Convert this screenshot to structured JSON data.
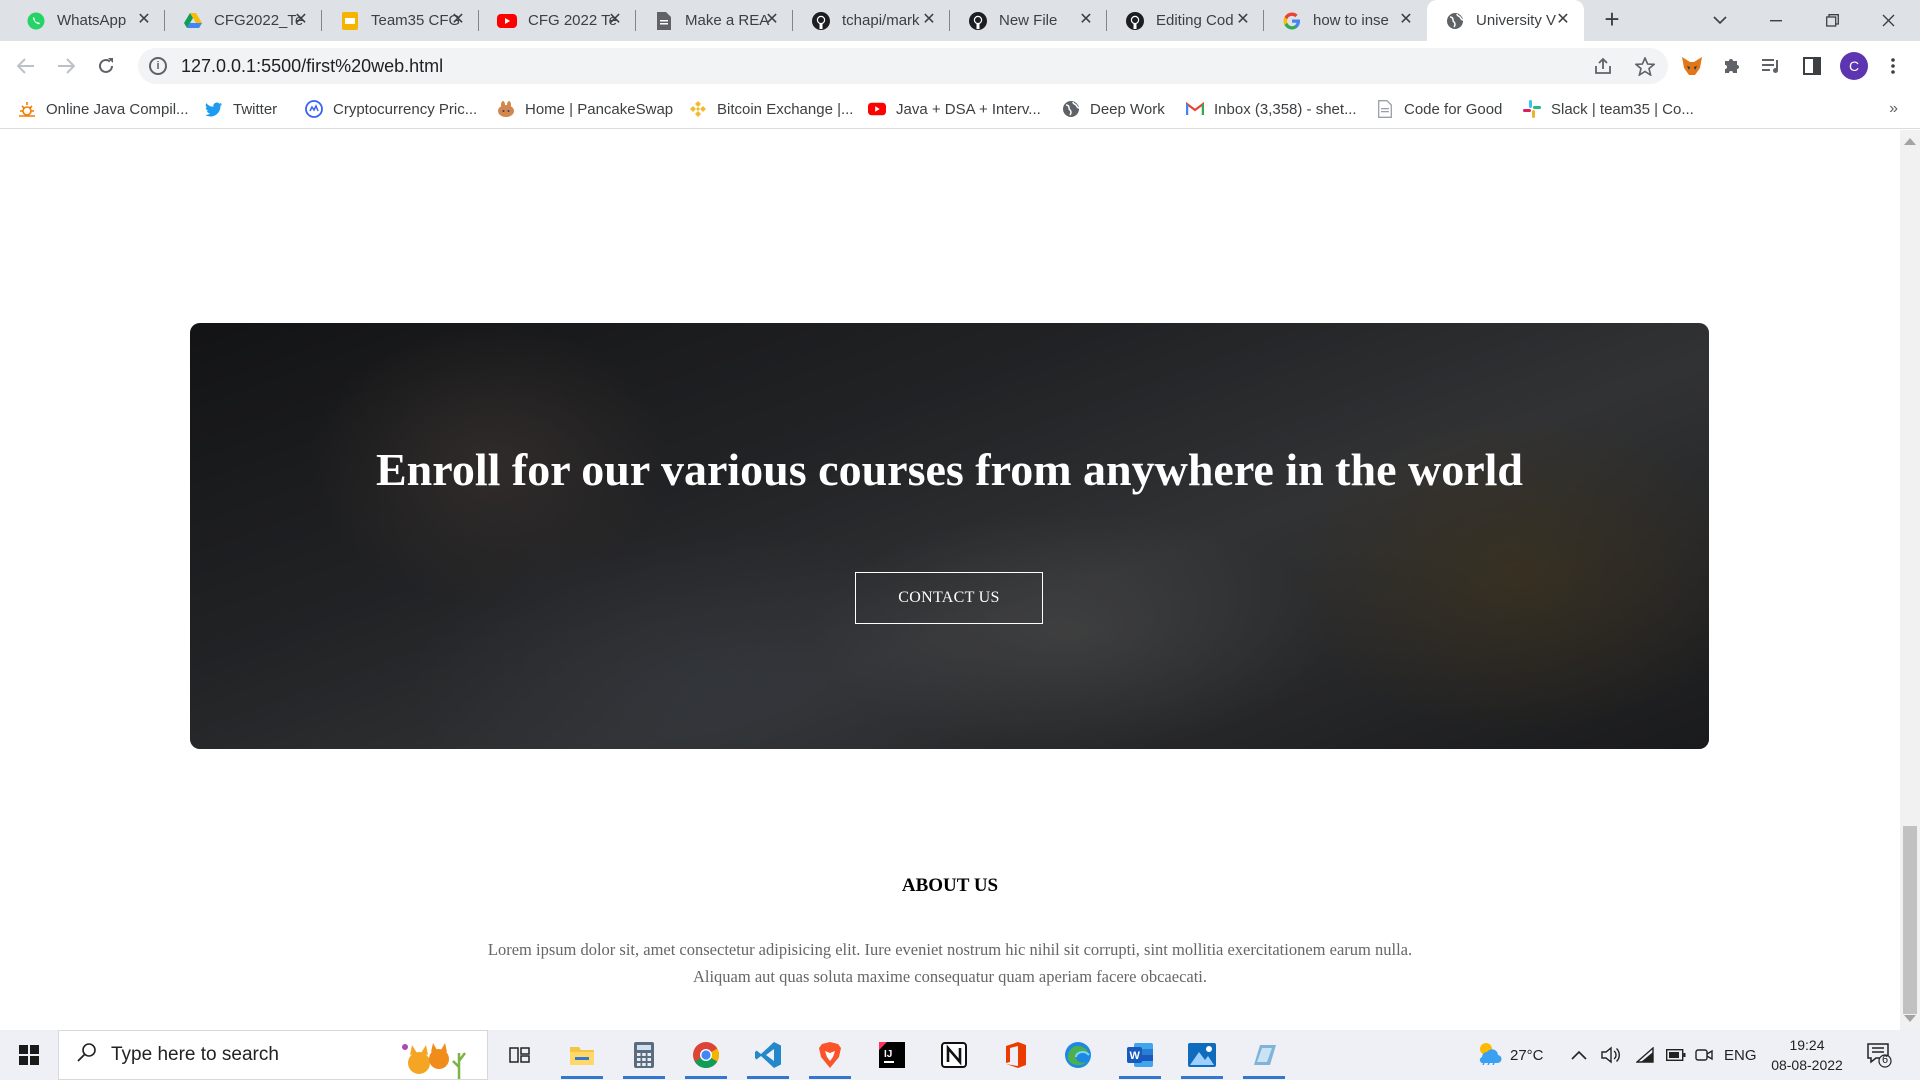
{
  "browser": {
    "tabs": [
      {
        "title": "WhatsApp",
        "icon": "whatsapp-icon",
        "active": false
      },
      {
        "title": "CFG2022_Te",
        "icon": "google-drive-icon",
        "active": false
      },
      {
        "title": "Team35 CFG",
        "icon": "google-slides-icon",
        "active": false
      },
      {
        "title": "CFG 2022 Te",
        "icon": "youtube-icon",
        "active": false
      },
      {
        "title": "Make a REA",
        "icon": "document-icon",
        "active": false
      },
      {
        "title": "tchapi/mark",
        "icon": "github-icon",
        "active": false
      },
      {
        "title": "New File",
        "icon": "github-icon",
        "active": false
      },
      {
        "title": "Editing Cod",
        "icon": "github-icon",
        "active": false
      },
      {
        "title": "how to inse",
        "icon": "google-icon",
        "active": false
      },
      {
        "title": "University V",
        "icon": "globe-icon",
        "active": true
      }
    ],
    "tab_close_glyph": "✕",
    "new_tab_glyph": "+",
    "address": "127.0.0.1:5500/first%20web.html",
    "avatar_letter": "C",
    "bookmarks": [
      {
        "label": "Online Java Compil...",
        "icon": "sun-icon"
      },
      {
        "label": "Twitter",
        "icon": "twitter-icon"
      },
      {
        "label": "Cryptocurrency Pric...",
        "icon": "coinmarketcap-icon"
      },
      {
        "label": "Home | PancakeSwap",
        "icon": "pancakeswap-icon"
      },
      {
        "label": "Bitcoin Exchange |...",
        "icon": "binance-icon"
      },
      {
        "label": "Java + DSA + Interv...",
        "icon": "youtube-icon"
      },
      {
        "label": "Deep Work",
        "icon": "globe-icon"
      },
      {
        "label": "Inbox (3,358) - shet...",
        "icon": "gmail-icon"
      },
      {
        "label": "Code for Good",
        "icon": "document-icon"
      },
      {
        "label": "Slack | team35 | Co...",
        "icon": "slack-icon"
      }
    ],
    "bookmarks_more": "»"
  },
  "page": {
    "hero": {
      "title": "Enroll for our various courses from anywhere in the world",
      "button": "CONTACT US"
    },
    "about": {
      "title": "ABOUT US",
      "line1": "Lorem ipsum dolor sit, amet consectetur adipisicing elit. Iure eveniet nostrum hic nihil sit corrupti, sint mollitia exercitationem earum nulla.",
      "line2": "Aliquam aut quas soluta maxime consequatur quam aperiam facere obcaecati."
    }
  },
  "taskbar": {
    "search_placeholder": "Type here to search",
    "apps": [
      {
        "name": "task-view-icon",
        "running": false
      },
      {
        "name": "file-explorer-icon",
        "running": true
      },
      {
        "name": "calculator-icon",
        "running": true
      },
      {
        "name": "chrome-icon",
        "running": true
      },
      {
        "name": "vscode-icon",
        "running": true
      },
      {
        "name": "brave-icon",
        "running": true
      },
      {
        "name": "intellij-icon",
        "running": false
      },
      {
        "name": "notion-icon",
        "running": false
      },
      {
        "name": "office-icon",
        "running": false
      },
      {
        "name": "edge-icon",
        "running": false
      },
      {
        "name": "word-icon",
        "running": true
      },
      {
        "name": "photos-icon",
        "running": true
      },
      {
        "name": "snipping-icon",
        "running": true
      }
    ],
    "weather": "27°C",
    "language": "ENG",
    "time": "19:24",
    "date": "08-08-2022",
    "notification_count": "6"
  },
  "colors": {
    "tabstrip": "#dee1e6",
    "accent_blue": "#1a73e8",
    "avatar": "#5e35b1",
    "about_text": "#666666"
  }
}
